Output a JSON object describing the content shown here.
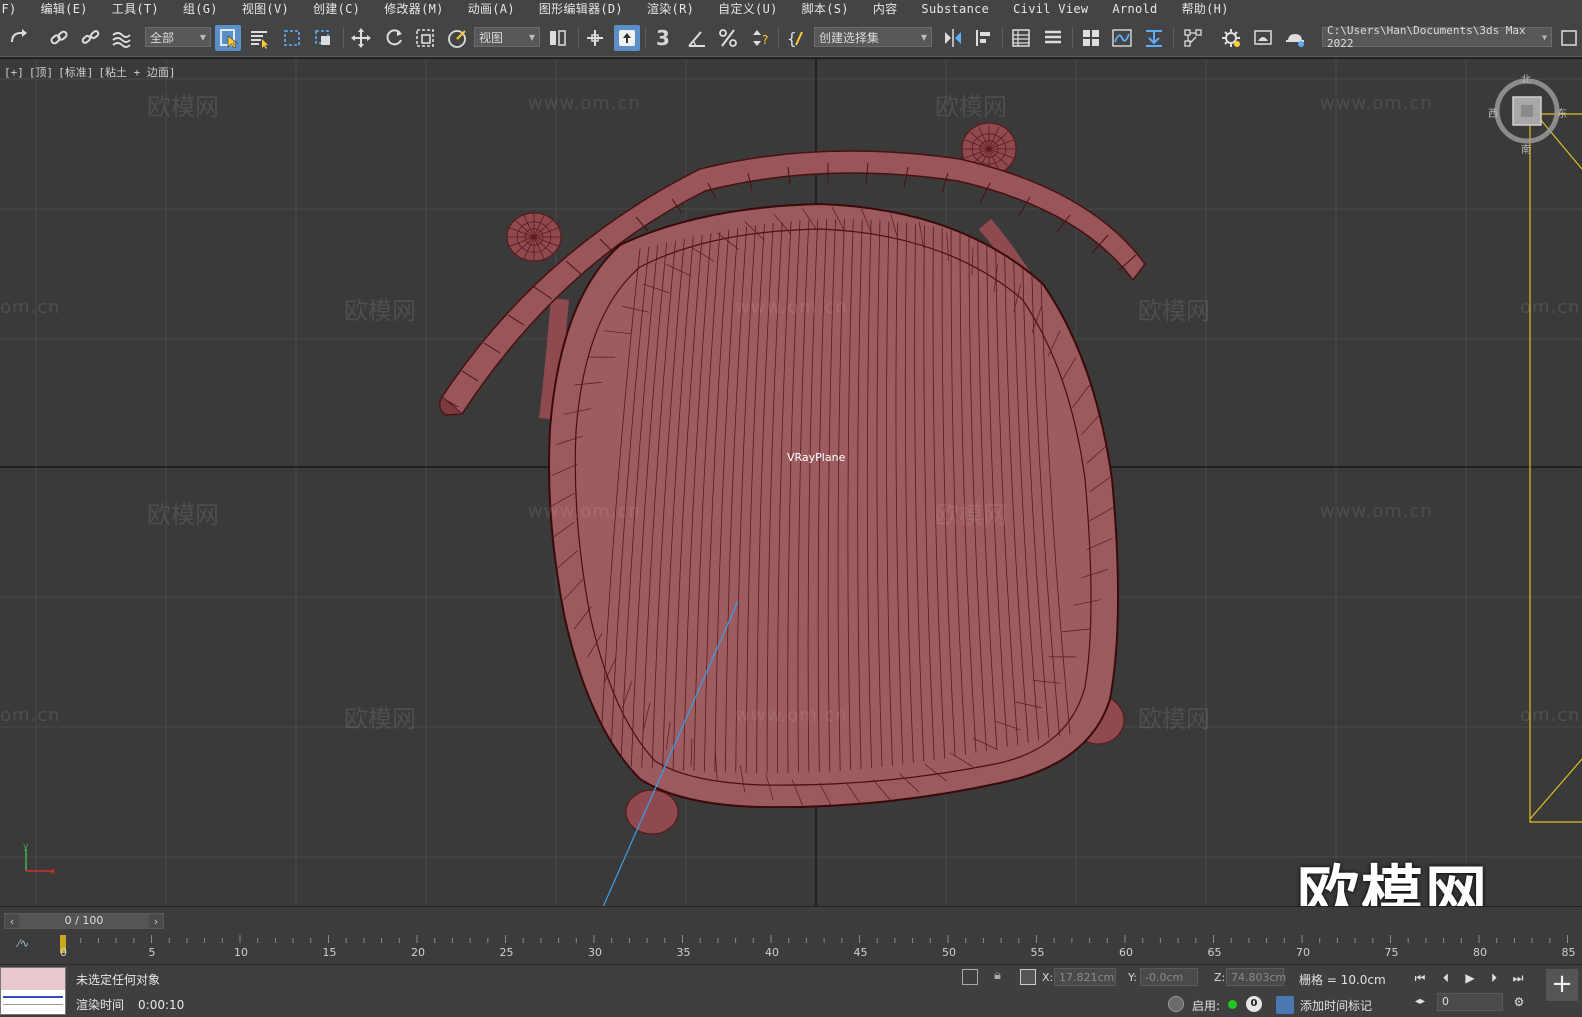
{
  "menu": [
    "(F)",
    "编辑(E)",
    "工具(T)",
    "组(G)",
    "视图(V)",
    "创建(C)",
    "修改器(M)",
    "动画(A)",
    "图形编辑器(D)",
    "渲染(R)",
    "自定义(U)",
    "脚本(S)",
    "内容",
    "Substance",
    "Civil View",
    "Arnold",
    "帮助(H)"
  ],
  "toolbar": {
    "filter_value": "全部",
    "ref_coord_value": "视图",
    "snap_number": "3",
    "selection_set_value": "创建选择集",
    "project_path": "C:\\Users\\Han\\Documents\\3ds Max 2022"
  },
  "viewport": {
    "label_plus": "[+]",
    "label_view": "[顶]",
    "label_shading": "[标准]",
    "label_mode": "[粘土 + 边面]",
    "object_name": "VRayPlane",
    "watermark_cn": "欧模网",
    "watermark_url": "www.om.cn",
    "watermark_url_partial": "om.cn",
    "big_watermark": "欧模网",
    "viewcube_labels": [
      "北",
      "西",
      "东",
      "南"
    ],
    "axis_labels": [
      "y",
      "x"
    ]
  },
  "timeline": {
    "frame_display": "0 / 100",
    "ticks": [
      "0",
      "5",
      "10",
      "15",
      "20",
      "25",
      "30",
      "35",
      "40",
      "45",
      "50",
      "55",
      "60",
      "65",
      "70",
      "75",
      "80",
      "85"
    ]
  },
  "status": {
    "message": "未选定任何对象",
    "render_time_label": "渲染时间",
    "render_time_value": "0:00:10",
    "x_label": "X:",
    "x_value": "17.821cm",
    "y_label": "Y:",
    "y_value": "-0.0cm",
    "z_label": "Z:",
    "z_value": "74.803cm",
    "grid_text": "栅格 = 10.0cm",
    "enable_label": "启用:",
    "zero_badge": "0",
    "add_time_tag": "添加时间标记",
    "frame_field": "0"
  },
  "colors": {
    "model_fill": "#9a5a5e",
    "model_wire": "#5a1a1a",
    "grid": "#4a4a4a",
    "active_tool": "#5b8fc7",
    "camera_line": "#3aa0e8",
    "light_frame": "#e0c020"
  }
}
